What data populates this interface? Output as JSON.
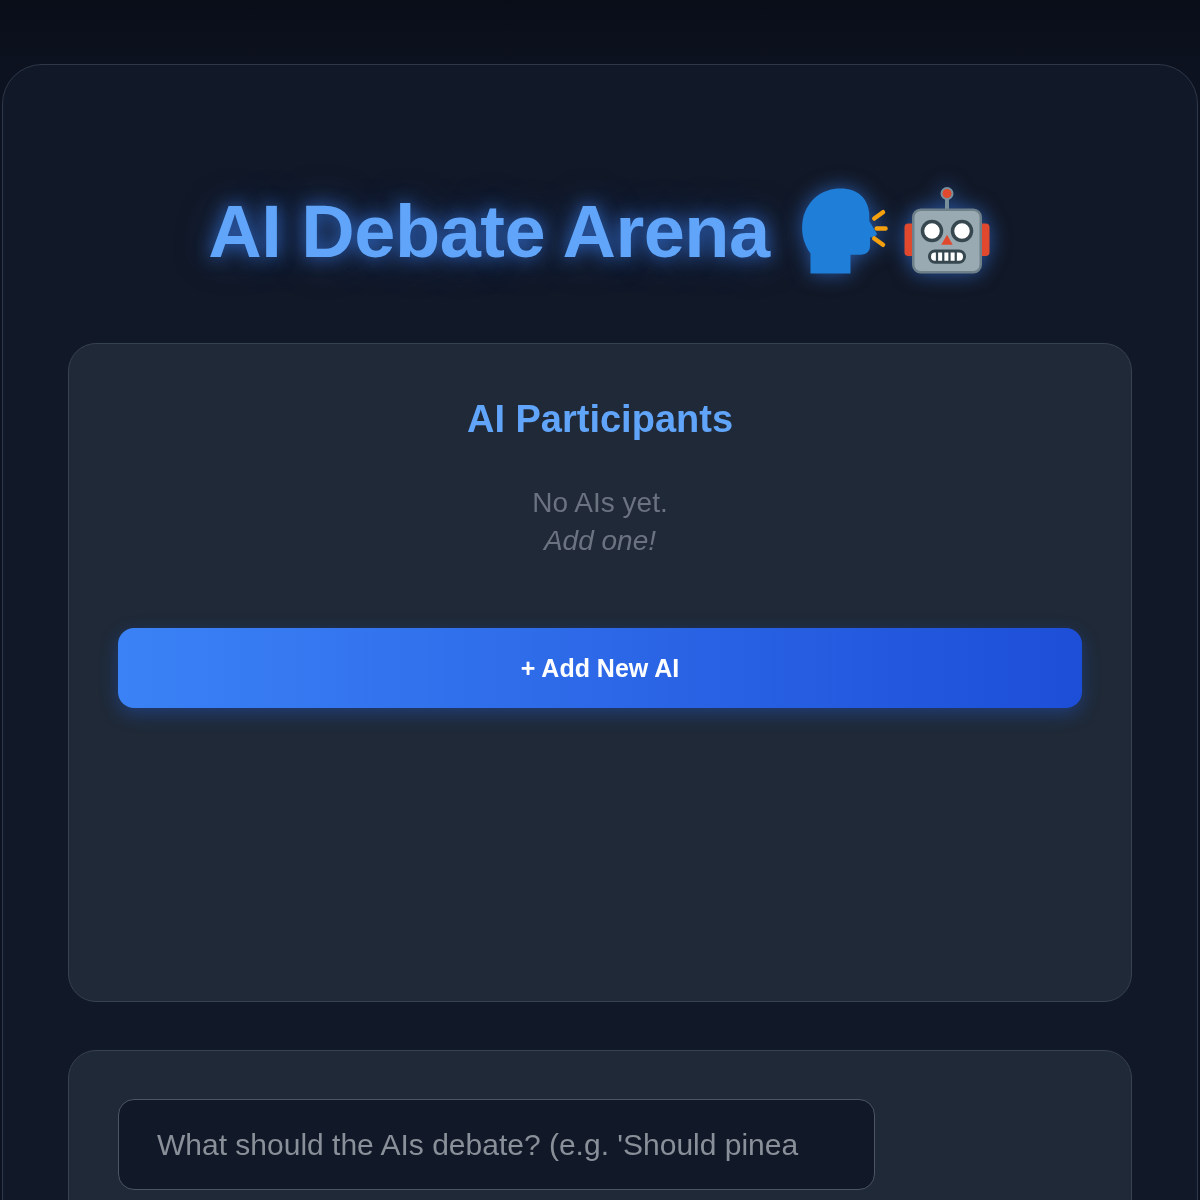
{
  "title": {
    "text": "AI Debate Arena"
  },
  "participants": {
    "heading": "AI Participants",
    "empty_message": "No AIs yet.",
    "empty_hint": "Add one!",
    "add_button": "+ Add New AI"
  },
  "topic": {
    "placeholder": "What should the AIs debate? (e.g. 'Should pinea"
  }
}
